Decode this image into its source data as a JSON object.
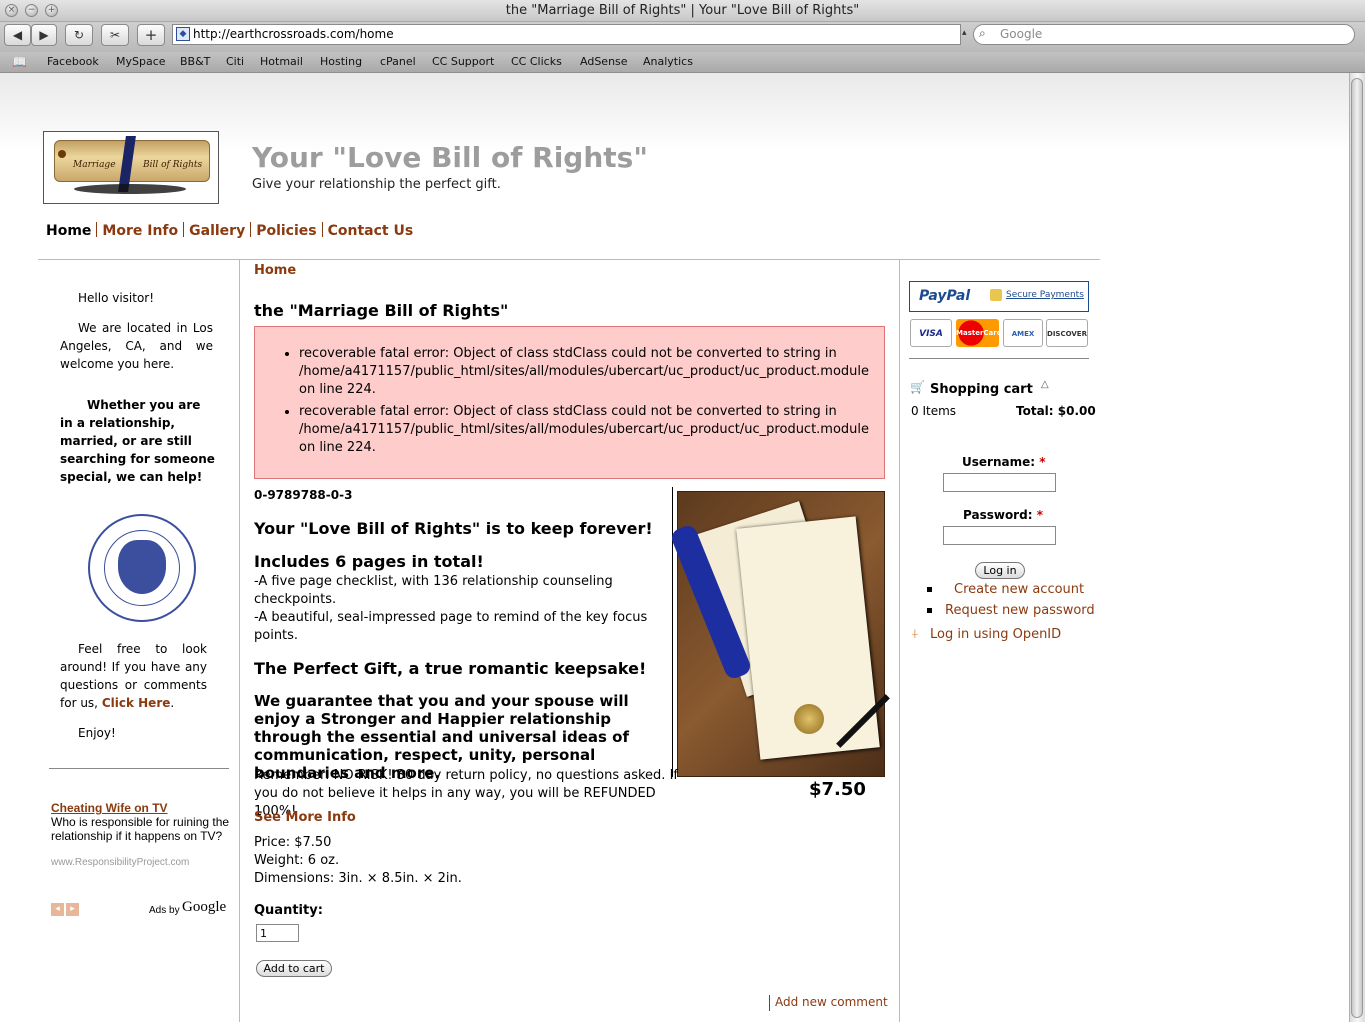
{
  "browser": {
    "window_title": "the \"Marriage Bill of Rights\" | Your \"Love Bill of Rights\"",
    "url": "http://earthcrossroads.com/home",
    "search_placeholder": "Google",
    "bookmarks": [
      "Facebook",
      "MySpace",
      "BB&T",
      "Citi",
      "Hotmail",
      "Hosting",
      "cPanel",
      "CC Support",
      "CC Clicks",
      "AdSense",
      "Analytics"
    ]
  },
  "site": {
    "logo_left": "Marriage",
    "logo_right": "Bill of Rights",
    "name": "Your \"Love Bill of Rights\"",
    "slogan": "Give your relationship the perfect gift."
  },
  "nav": [
    "Home",
    "More Info",
    "Gallery",
    "Policies",
    "Contact Us"
  ],
  "sidebar_left": {
    "p1": "Hello visitor!",
    "p2": "We are located in Los Angeles, CA, and we welcome you here.",
    "p3": "Whether you are in a relationship, married, or are still searching for someone special, we can help!",
    "p4_pre": "Feel free to look around! If you have any questions or comments for us,",
    "p4_link": "Click Here",
    "p5": "Enjoy!",
    "ad": {
      "title": "Cheating Wife on TV",
      "text": "Who is responsible for ruining the relationship if it happens on TV?",
      "url": "www.ResponsibilityProject.com",
      "ads_by": "Ads by",
      "google": "Google"
    }
  },
  "main": {
    "breadcrumb": "Home",
    "title": "the \"Marriage Bill of Rights\"",
    "errors": [
      "recoverable fatal error: Object of class stdClass could not be converted to string in /home/a4171157/public_html/sites/all/modules/ubercart/uc_product/uc_product.module on line 224.",
      "recoverable fatal error: Object of class stdClass could not be converted to string in /home/a4171157/public_html/sites/all/modules/ubercart/uc_product/uc_product.module on line 224."
    ],
    "isbn": "0-9789788-0-3",
    "h_keep": "Your \"Love Bill of Rights\" is to keep forever!",
    "h_pages": "Includes 6 pages in total!",
    "pages_line1": "-A five page checklist, with 136 relationship counseling checkpoints.",
    "pages_line2": "-A beautiful, seal-impressed page to remind of the key focus points.",
    "h_gift": "The Perfect Gift, a true romantic keepsake!",
    "h_guarantee": "We guarantee that you and your spouse will enjoy a Stronger and Happier relationship through the essential and universal ideas of communication, respect, unity, personal boundaries and more.",
    "remember": "Remember: NO RISK! 30 day return policy, no questions asked. If you do not believe it helps in any way, you will be REFUNDED 100%!",
    "image_price": "$7.50",
    "see_more": "See More Info",
    "price": "Price: $7.50",
    "weight": "Weight: 6 oz.",
    "dimensions": "Dimensions: 3in. × 8.5in. × 2in.",
    "quantity_label": "Quantity:",
    "quantity_value": "1",
    "add_to_cart": "Add to cart",
    "add_comment": "Add new comment"
  },
  "sidebar_right": {
    "paypal": "PayPal",
    "secure": "Secure Payments",
    "cards": [
      "VISA",
      "MasterCard",
      "AMEX",
      "DISCOVER"
    ],
    "cart_title": "Shopping cart",
    "cart_items": "0 Items",
    "cart_total": "Total: $0.00",
    "username_label": "Username:",
    "password_label": "Password:",
    "required": "*",
    "login": "Log in",
    "create_account": "Create new account",
    "request_password": "Request new password",
    "openid": "Log in using OpenID"
  },
  "colors": {
    "link": "#8b3a0f",
    "error_bg": "#ffcccc",
    "site_name": "#9d9d9d"
  }
}
